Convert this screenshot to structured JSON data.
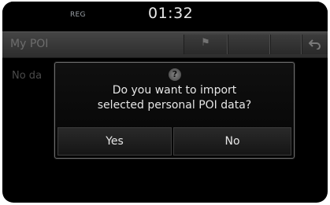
{
  "status": {
    "reg": "REG",
    "clock": "01:32"
  },
  "titlebar": {
    "title": "My POI"
  },
  "body": {
    "text": "No da"
  },
  "dialog": {
    "line1": "Do you want to import",
    "line2": "selected personal POI data?",
    "yes": "Yes",
    "no": "No"
  }
}
